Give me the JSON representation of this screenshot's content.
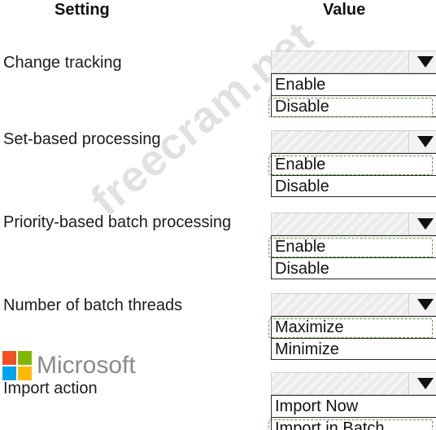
{
  "headers": {
    "setting": "Setting",
    "value": "Value"
  },
  "watermark": "freecram.net",
  "logo": {
    "word": "Microsoft",
    "colors": [
      "#f25022",
      "#7fba00",
      "#00a4ef",
      "#ffb900"
    ]
  },
  "rows": [
    {
      "label": "Change tracking",
      "options": [
        "Enable",
        "Disable"
      ],
      "selected": "Disable"
    },
    {
      "label": "Set-based processing",
      "options": [
        "Enable",
        "Disable"
      ],
      "selected": "Enable"
    },
    {
      "label": "Priority-based batch processing",
      "options": [
        "Enable",
        "Disable"
      ],
      "selected": "Enable"
    },
    {
      "label": "Number of batch threads",
      "options": [
        "Maximize",
        "Minimize"
      ],
      "selected": "Maximize"
    },
    {
      "label": "Import action",
      "options": [
        "Import Now",
        "Import in Batch"
      ],
      "selected": "Import in Batch"
    }
  ]
}
